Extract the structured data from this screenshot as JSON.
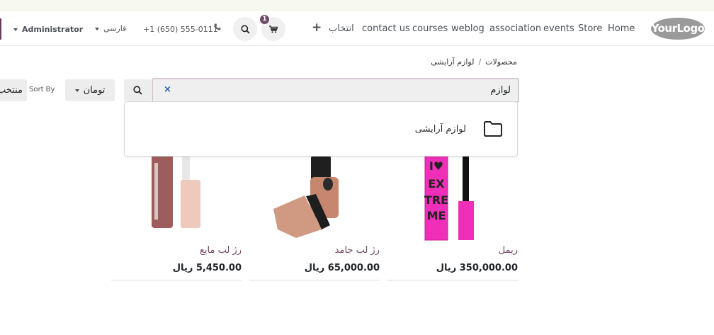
{
  "nav": {
    "logo": "YourLogo",
    "links": [
      "Home",
      "Store",
      "events",
      "association",
      "weblog",
      "courses",
      "contact us",
      "انتخاب"
    ],
    "add_icon": "plus-icon",
    "cart_count": "1",
    "cart_icon": "cart-icon",
    "search_icon": "search-icon",
    "phone": "+1 (650) 555-0111",
    "phone_icon": "phone-icon",
    "language": "فارسی",
    "user": "Administrator"
  },
  "breadcrumb": {
    "items": [
      "محصولات",
      "لوازم آرایشی"
    ],
    "separator": "/"
  },
  "search": {
    "value": "لوازم",
    "clear": "×"
  },
  "filters": {
    "currency": "تومان",
    "sort_label": "Sort By",
    "cut_button": "منتخب"
  },
  "dropdown": {
    "items": [
      {
        "label": "لوازم آرایشی",
        "icon": "folder-icon"
      }
    ]
  },
  "products": [
    {
      "name": "ریمل",
      "price": "350,000.00 ریال"
    },
    {
      "name": "رژ لب جامد",
      "price": "65,000.00 ریال"
    },
    {
      "name": "رژ لب مایع",
      "price": "5,450.00 ریال"
    }
  ],
  "colors": {
    "accent": "#714b67",
    "topstrip": "#f7f9ef"
  }
}
